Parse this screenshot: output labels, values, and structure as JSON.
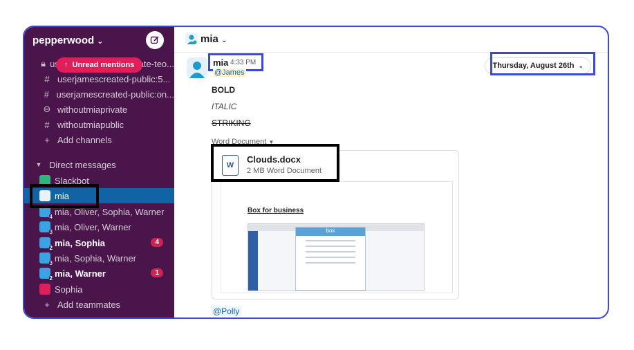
{
  "workspace": {
    "name": "pepperwood"
  },
  "sidebar": {
    "unread_label": "Unread mentions",
    "partial_channel": "userjamescreated-private-teo...",
    "channels": [
      {
        "label": "userjamescreated-public:5...",
        "type": "public"
      },
      {
        "label": "userjamescreated-public:on...",
        "type": "public"
      },
      {
        "label": "withoutmiaprivate",
        "type": "private"
      },
      {
        "label": "withoutmiapublic",
        "type": "public"
      }
    ],
    "add_channels": "Add channels",
    "dm_header": "Direct messages",
    "dms": [
      {
        "label": "Slackbot",
        "kind": "bot"
      },
      {
        "label": "mia",
        "kind": "self",
        "active": true
      },
      {
        "label": "mia, Oliver, Sophia, Warner",
        "kind": "group",
        "count": "4"
      },
      {
        "label": "mia, Oliver, Warner",
        "kind": "group",
        "count": "3"
      },
      {
        "label": "mia, Sophia",
        "kind": "group",
        "count": "2",
        "bold": true,
        "badge": "4"
      },
      {
        "label": "mia, Sophia, Warner",
        "kind": "group",
        "count": "3"
      },
      {
        "label": "mia, Warner",
        "kind": "group",
        "count": "2",
        "bold": true,
        "badge": "1"
      },
      {
        "label": "Sophia",
        "kind": "user"
      }
    ],
    "add_teammates": "Add teammates"
  },
  "channel": {
    "title": "mia"
  },
  "date_divider": "Thursday, August 26th",
  "message": {
    "author": "mia",
    "time": "4:33 PM",
    "mention": "@James",
    "bold_text": "BOLD",
    "italic_text": "ITALIC",
    "strike_text": "STRIKING",
    "attachment_label": "Word Document",
    "file_name": "Clouds.docx",
    "file_desc": "2 MB Word Document",
    "file_icon_letter": "W",
    "preview_title": "Box for business",
    "preview_box_label": "box",
    "trailing_mention": "@Polly"
  },
  "colors": {
    "sidebar_bg": "#4a154b",
    "active_item": "#1164a3",
    "badge": "#cd2553",
    "unread_pill": "#e01e5a",
    "annotation": "#3b49d6"
  }
}
